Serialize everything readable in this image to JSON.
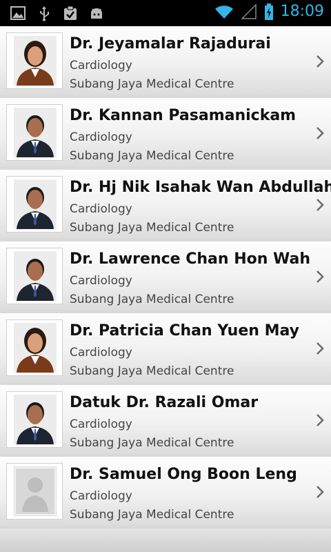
{
  "status_bar": {
    "time": "18:09",
    "left_icons": [
      "image-icon",
      "usb-icon",
      "clipboard-check-icon",
      "android-icon"
    ],
    "right_icons": [
      "wifi-icon",
      "signal-icon",
      "battery-charging-icon"
    ],
    "accent_color": "#33b5e5"
  },
  "doctors": [
    {
      "name": "Dr. Jeyamalar Rajadurai",
      "specialty": "Cardiology",
      "hospital": "Subang Jaya Medical Centre",
      "photo": "female-doctor-photo"
    },
    {
      "name": "Dr. Kannan Pasamanickam",
      "specialty": "Cardiology",
      "hospital": "Subang Jaya Medical Centre",
      "photo": "male-doctor-photo"
    },
    {
      "name": "Dr. Hj Nik Isahak Wan Abdullah",
      "specialty": "Cardiology",
      "hospital": "Subang Jaya Medical Centre",
      "photo": "male-doctor-photo"
    },
    {
      "name": "Dr. Lawrence Chan Hon Wah",
      "specialty": "Cardiology",
      "hospital": "Subang Jaya Medical Centre",
      "photo": "male-doctor-photo"
    },
    {
      "name": "Dr. Patricia Chan Yuen May",
      "specialty": "Cardiology",
      "hospital": "Subang Jaya Medical Centre",
      "photo": "female-doctor-photo"
    },
    {
      "name": "Datuk Dr. Razali Omar",
      "specialty": "Cardiology",
      "hospital": "Subang Jaya Medical Centre",
      "photo": "male-doctor-photo"
    },
    {
      "name": "Dr. Samuel Ong Boon Leng",
      "specialty": "Cardiology",
      "hospital": "Subang Jaya Medical Centre",
      "photo": "placeholder-avatar"
    }
  ]
}
